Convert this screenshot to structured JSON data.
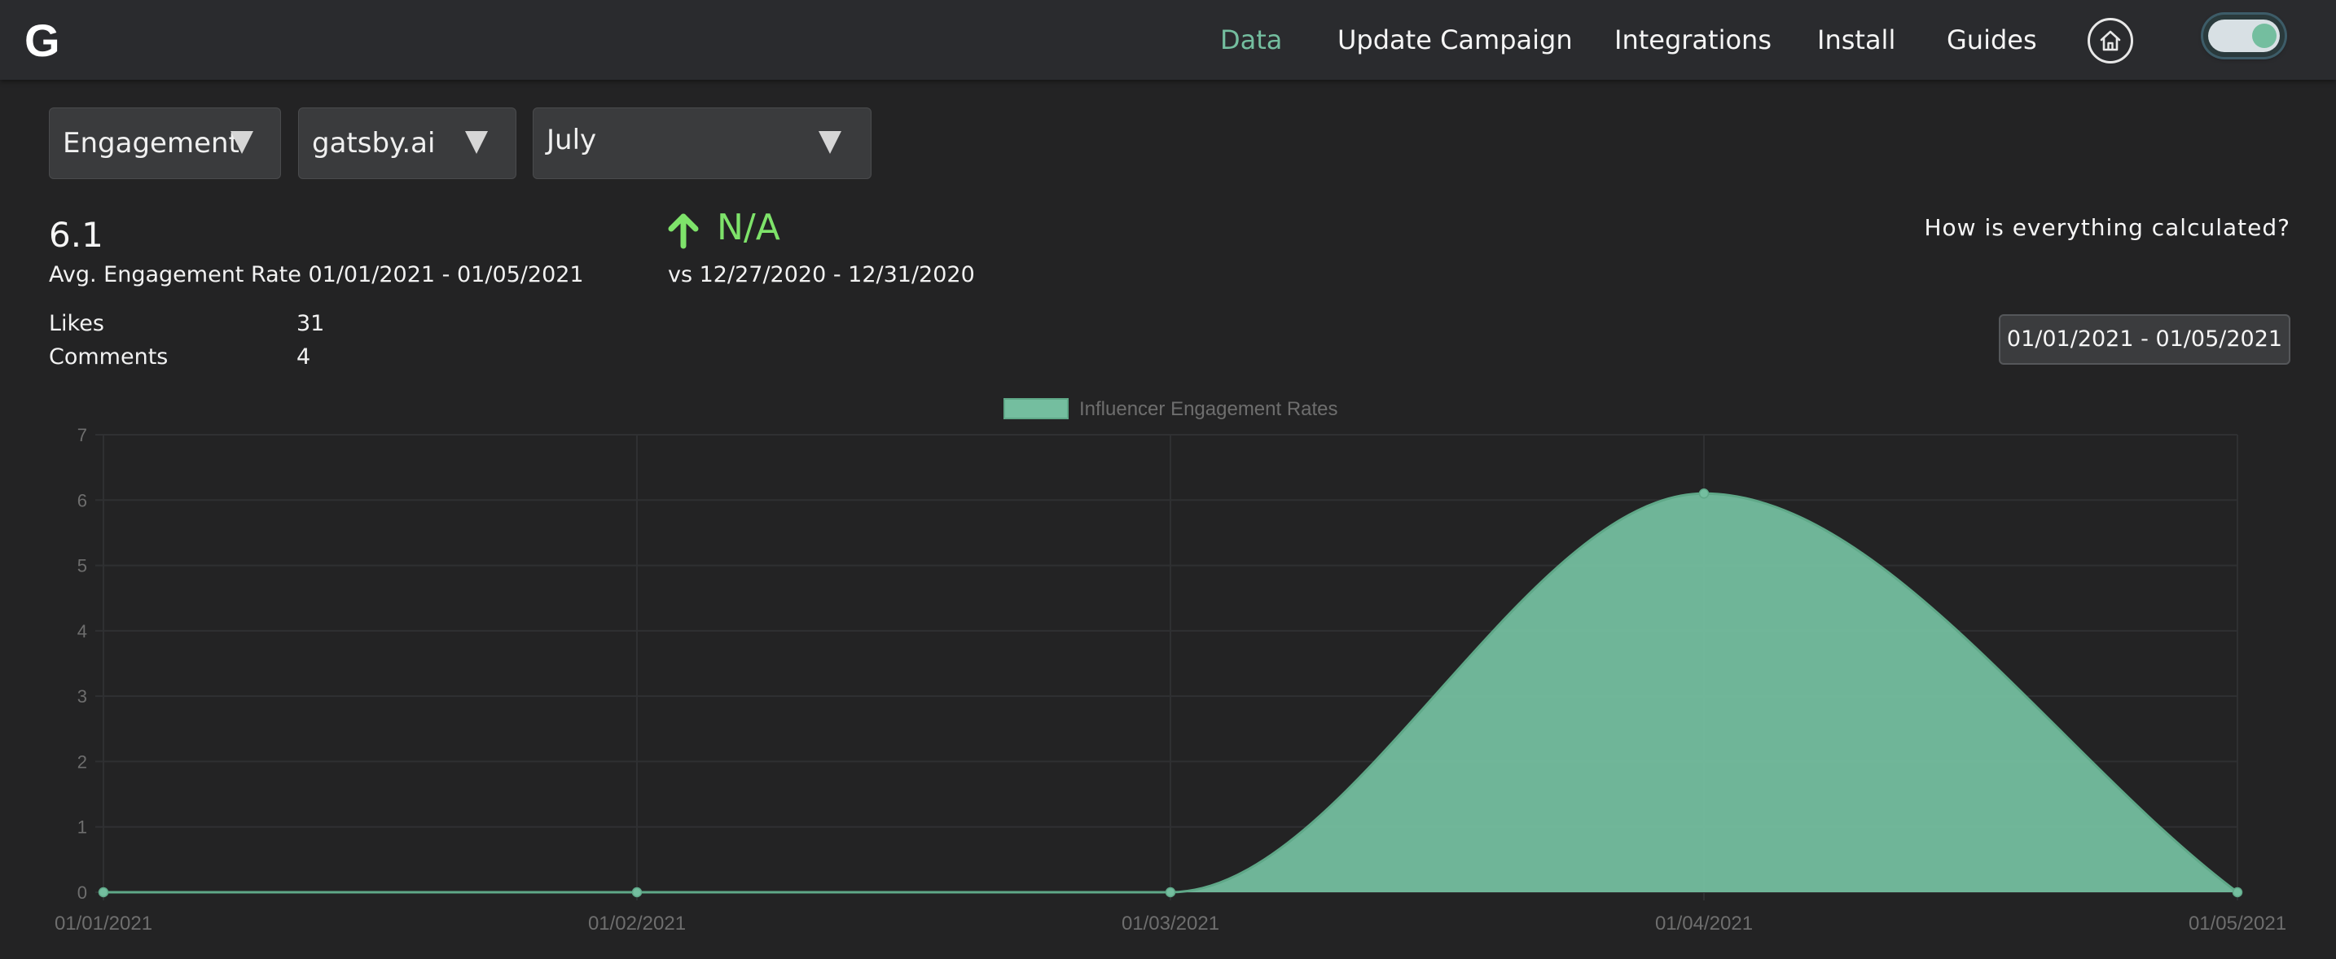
{
  "header": {
    "logo": "G",
    "nav": [
      {
        "label": "Data",
        "active": true
      },
      {
        "label": "Update Campaign",
        "active": false
      },
      {
        "label": "Integrations",
        "active": false
      },
      {
        "label": "Install",
        "active": false
      },
      {
        "label": "Guides",
        "active": false
      }
    ],
    "home_icon": "home-icon",
    "theme_toggle_on": true
  },
  "filters": {
    "metric": "Engagement",
    "account": "gatsby.ai",
    "month": "July"
  },
  "summary": {
    "value": "6.1",
    "label": "Avg. Engagement Rate 01/01/2021 - 01/05/2021",
    "change": "N/A",
    "change_icon": "arrow-up-icon",
    "comparison": "vs 12/27/2020 - 12/31/2020",
    "how_link": "How is everything calculated?",
    "date_range": "01/01/2021 - 01/05/2021",
    "stats": [
      {
        "label": "Likes",
        "value": "31"
      },
      {
        "label": "Comments",
        "value": "4"
      }
    ]
  },
  "colors": {
    "accent": "#74be9f",
    "positive": "#7ee36a",
    "background": "#232324",
    "header": "#2a2b2e"
  },
  "chart_data": {
    "type": "area",
    "x": [
      "01/01/2021",
      "01/02/2021",
      "01/03/2021",
      "01/04/2021",
      "01/05/2021"
    ],
    "series": [
      {
        "name": "Influencer Engagement Rates",
        "values": [
          0,
          0,
          0,
          6.1,
          0
        ],
        "color": "#74be9f"
      }
    ],
    "ylim": [
      0,
      7
    ],
    "yticks": [
      0,
      1,
      2,
      3,
      4,
      5,
      6,
      7
    ],
    "legend": "top-center",
    "grid": true,
    "smooth": true
  }
}
